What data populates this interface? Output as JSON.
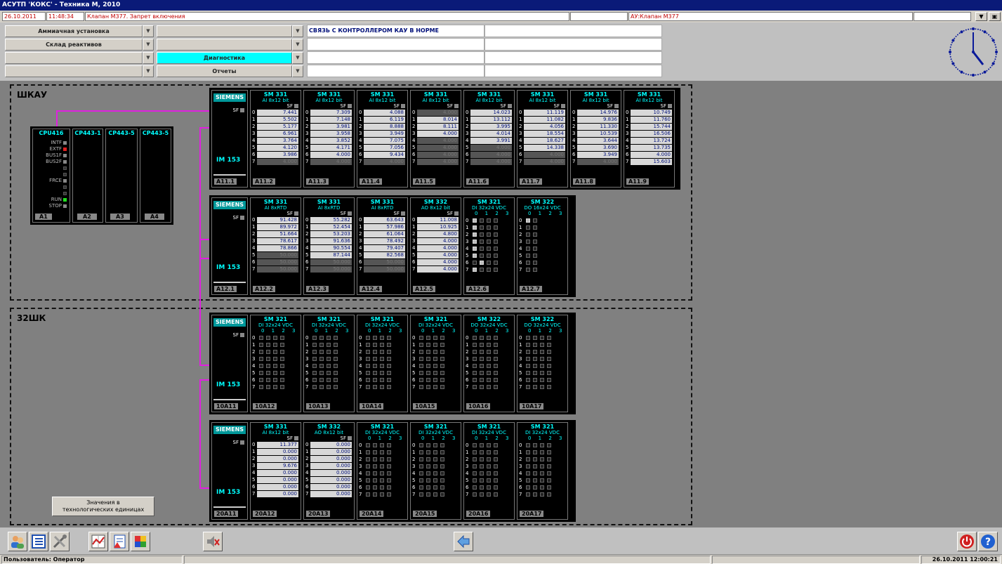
{
  "window": {
    "title": "АСУТП 'КОКС' - Техника М, 2010"
  },
  "alarm": {
    "date": "26.10.2011",
    "time": "11:48:34",
    "message": "Клапан М377. Запрет включения",
    "source": "АУ:Клапан М377"
  },
  "nav": {
    "col1": [
      "Аммиачная установка",
      "Склад реактивов",
      "",
      ""
    ],
    "col2": [
      "",
      "",
      "Диагностика",
      "Отчеты"
    ],
    "message": "СВЯЗЬ С КОНТРОЛЛЕРОМ КАУ В НОРМЕ"
  },
  "cpu_rack": {
    "modules": [
      {
        "name": "CPU416",
        "tag": "A1",
        "statuses": [
          "INTF",
          "EXTF",
          "BUS1F",
          "BUS2F",
          "",
          "",
          "FRCE",
          "",
          "",
          "RUN",
          "STOP"
        ]
      },
      {
        "name": "CP443-1",
        "tag": "A2"
      },
      {
        "name": "CP443-5",
        "tag": "A3"
      },
      {
        "name": "CP443-5",
        "tag": "A4"
      }
    ]
  },
  "cabinets": [
    {
      "title": "ШКАУ"
    },
    {
      "title": "32ШК"
    }
  ],
  "racks": [
    {
      "im": {
        "brand": "SIEMENS",
        "sf": "SF",
        "label": "IM 153",
        "tag": "A11.1"
      },
      "modules": [
        {
          "type": "ai",
          "title": "SM 331",
          "sub": "AI 8x12 bit",
          "tag": "A11.2",
          "values": [
            "7.441",
            "5.502",
            "5.177",
            "6.961",
            "3.764",
            "4.120",
            "3.986",
            "4.000"
          ],
          "inactive": [
            false,
            false,
            false,
            false,
            false,
            false,
            false,
            true
          ]
        },
        {
          "type": "ai",
          "title": "SM 331",
          "sub": "AI 8x12 bit",
          "tag": "A11.3",
          "values": [
            "7.309",
            "7.148",
            "3.981",
            "3.958",
            "3.852",
            "4.171",
            "4.000",
            "4.000"
          ],
          "inactive": [
            false,
            false,
            false,
            false,
            false,
            false,
            false,
            true
          ]
        },
        {
          "type": "ai",
          "title": "SM 331",
          "sub": "AI 8x12 bit",
          "tag": "A11.4",
          "values": [
            "4.088",
            "6.119",
            "8.888",
            "3.949",
            "7.075",
            "7.056",
            "9.434",
            "4.000"
          ],
          "inactive": [
            false,
            false,
            false,
            false,
            false,
            false,
            false,
            true
          ]
        },
        {
          "type": "ai",
          "title": "SM 331",
          "sub": "AI 8x12 bit",
          "tag": "A11.5",
          "values": [
            "4.000",
            "8.014",
            "8.111",
            "4.000",
            "4.000",
            "4.000",
            "4.000",
            "4.000"
          ],
          "inactive": [
            true,
            false,
            false,
            false,
            true,
            true,
            true,
            true
          ]
        },
        {
          "type": "ai",
          "title": "SM 331",
          "sub": "AI 8x12 bit",
          "tag": "A11.6",
          "values": [
            "14.023",
            "13.112",
            "3.995",
            "4.014",
            "3.991",
            "4.000",
            "4.000",
            "4.000"
          ],
          "inactive": [
            false,
            false,
            false,
            false,
            false,
            true,
            true,
            true
          ]
        },
        {
          "type": "ai",
          "title": "SM 331",
          "sub": "AI 8x12 bit",
          "tag": "A11.7",
          "values": [
            "11.119",
            "11.082",
            "4.056",
            "18.554",
            "18.627",
            "14.338",
            "4.000",
            "4.000"
          ],
          "inactive": [
            false,
            false,
            false,
            false,
            false,
            false,
            true,
            true
          ]
        },
        {
          "type": "ai",
          "title": "SM 331",
          "sub": "AI 8x12 bit",
          "tag": "A11.8",
          "values": [
            "14.976",
            "9.836",
            "11.330",
            "10.539",
            "3.644",
            "3.690",
            "3.949",
            "4.000"
          ],
          "inactive": [
            false,
            false,
            false,
            false,
            false,
            false,
            false,
            true
          ]
        },
        {
          "type": "ai",
          "title": "SM 331",
          "sub": "AI 8x12 bit",
          "tag": "A11.9",
          "values": [
            "10.749",
            "11.760",
            "15.744",
            "16.506",
            "13.724",
            "13.735",
            "4.000",
            "15.603"
          ],
          "inactive": [
            false,
            false,
            false,
            false,
            false,
            false,
            false,
            false
          ]
        }
      ]
    },
    {
      "im": {
        "brand": "SIEMENS",
        "sf": "SF",
        "label": "IM 153",
        "tag": "A12.1"
      },
      "modules": [
        {
          "type": "ai",
          "title": "SM 331",
          "sub": "AI 8xRTD",
          "tag": "A12.2",
          "values": [
            "91.428",
            "89.972",
            "51.664",
            "78.617",
            "78.866",
            "50.000",
            "50.000",
            "50.000"
          ],
          "inactive": [
            false,
            false,
            false,
            false,
            false,
            true,
            true,
            true
          ]
        },
        {
          "type": "ai",
          "title": "SM 331",
          "sub": "AI 8xRTD",
          "tag": "A12.3",
          "values": [
            "55.282",
            "52.454",
            "53.203",
            "91.636",
            "90.554",
            "87.144",
            "50.000",
            "50.000"
          ],
          "inactive": [
            false,
            false,
            false,
            false,
            false,
            false,
            true,
            true
          ]
        },
        {
          "type": "ai",
          "title": "SM 331",
          "sub": "AI 8xRTD",
          "tag": "A12.4",
          "values": [
            "63.643",
            "57.986",
            "61.064",
            "78.492",
            "79.407",
            "82.568",
            "50.000",
            "50.000"
          ],
          "inactive": [
            false,
            false,
            false,
            false,
            false,
            false,
            true,
            true
          ]
        },
        {
          "type": "ai",
          "title": "SM 332",
          "sub": "AO 8x12 bit",
          "tag": "A12.5",
          "values": [
            "11.008",
            "10.925",
            "4.800",
            "4.000",
            "4.000",
            "4.000",
            "4.000",
            "4.000"
          ],
          "inactive": [
            false,
            false,
            false,
            false,
            false,
            false,
            false,
            false
          ]
        },
        {
          "type": "di",
          "title": "SM 321",
          "sub": "DI 32x24 VDC",
          "tag": "A12.6",
          "header": "0 1 2 3",
          "leds": [
            [
              1,
              0,
              0,
              0
            ],
            [
              1,
              0,
              0,
              0
            ],
            [
              1,
              0,
              0,
              0
            ],
            [
              1,
              0,
              0,
              0
            ],
            [
              1,
              0,
              0,
              0
            ],
            [
              1,
              0,
              0,
              0
            ],
            [
              0,
              1,
              0,
              0
            ],
            [
              1,
              0,
              0,
              0
            ]
          ]
        },
        {
          "type": "di",
          "title": "SM 322",
          "sub": "DO 16x24 VDC",
          "tag": "A12.7",
          "header": "0 1 2 3",
          "leds": [
            [
              1,
              0
            ],
            [
              0,
              0
            ],
            [
              0,
              0
            ],
            [
              0,
              0
            ],
            [
              0,
              0
            ],
            [
              0,
              0
            ],
            [
              0,
              0
            ],
            [
              0,
              0
            ]
          ]
        }
      ]
    },
    {
      "im": {
        "brand": "SIEMENS",
        "sf": "SF",
        "label": "IM 153",
        "tag": "10A11"
      },
      "modules": [
        {
          "type": "di",
          "title": "SM 321",
          "sub": "DI 32x24 VDC",
          "tag": "10A12",
          "header": "0 1 2 3"
        },
        {
          "type": "di",
          "title": "SM 321",
          "sub": "DI 32x24 VDC",
          "tag": "10A13",
          "header": "0 1 2 3"
        },
        {
          "type": "di",
          "title": "SM 321",
          "sub": "DI 32x24 VDC",
          "tag": "10A14",
          "header": "0 1 2 3"
        },
        {
          "type": "di",
          "title": "SM 321",
          "sub": "DI 32x24 VDC",
          "tag": "10A15",
          "header": "0 1 2 3"
        },
        {
          "type": "di",
          "title": "SM 322",
          "sub": "DO 32x24 VDC",
          "tag": "10A16",
          "header": "0 1 2 3"
        },
        {
          "type": "di",
          "title": "SM 322",
          "sub": "DO 32x24 VDC",
          "tag": "10A17",
          "header": "0 1 2 3"
        }
      ]
    },
    {
      "im": {
        "brand": "SIEMENS",
        "sf": "SF",
        "label": "IM 153",
        "tag": "20A11"
      },
      "modules": [
        {
          "type": "ai",
          "title": "SM 331",
          "sub": "AI 8x12 bit",
          "tag": "20A12",
          "values": [
            "11.377",
            "0.000",
            "0.000",
            "9.676",
            "0.000",
            "0.000",
            "0.000",
            "0.000"
          ],
          "inactive": [
            false,
            false,
            false,
            false,
            false,
            false,
            false,
            false
          ]
        },
        {
          "type": "ai",
          "title": "SM 332",
          "sub": "AO 8x12 bit",
          "tag": "20A13",
          "values": [
            "0.000",
            "0.000",
            "0.000",
            "0.000",
            "0.000",
            "0.000",
            "0.000",
            "0.000"
          ],
          "inactive": [
            false,
            false,
            false,
            false,
            false,
            false,
            false,
            false
          ]
        },
        {
          "type": "di",
          "title": "SM 321",
          "sub": "DI 32x24 VDC",
          "tag": "20A14",
          "header": "0 1 2 3"
        },
        {
          "type": "di",
          "title": "SM 321",
          "sub": "DI 32x24 VDC",
          "tag": "20A15",
          "header": "0 1 2 3"
        },
        {
          "type": "di",
          "title": "SM 321",
          "sub": "DI 32x24 VDC",
          "tag": "20A16",
          "header": "0 1 2 3"
        },
        {
          "type": "di",
          "title": "SM 321",
          "sub": "DI 32x24 VDC",
          "tag": "20A17",
          "header": "0 1 2 3"
        }
      ]
    }
  ],
  "values_button": {
    "line1": "Значения в",
    "line2": "технологических единицах"
  },
  "toolbar": {
    "icons": [
      "users-icon",
      "list-icon",
      "tools-icon",
      "trend-icon",
      "report-icon",
      "palette-icon",
      "sound-off-icon",
      "back-arrow-icon",
      "power-icon",
      "help-icon"
    ]
  },
  "status": {
    "user": "Пользователь: Оператор",
    "datetime": "26.10.2011  12:00:21"
  },
  "colors": {
    "accent_cyan": "#00ffff",
    "wire_magenta": "#e020e0",
    "siemens_teal": "#00989a",
    "alarm_red": "#c00000"
  }
}
